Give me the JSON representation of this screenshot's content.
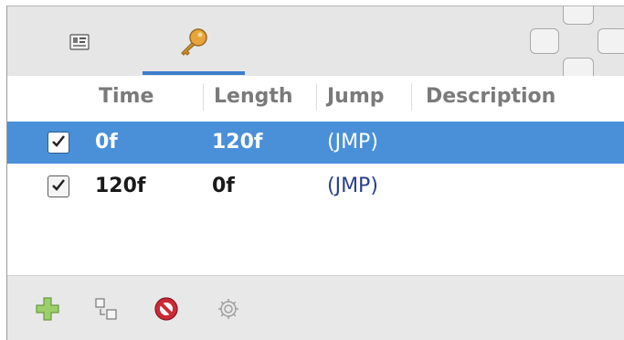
{
  "tabs": [
    {
      "name": "ids-tab",
      "icon": "id-card-icon",
      "active": false
    },
    {
      "name": "keys-tab",
      "icon": "key-icon",
      "active": true
    }
  ],
  "table": {
    "columns": [
      "Time",
      "Length",
      "Jump",
      "Description"
    ],
    "rows": [
      {
        "checked": true,
        "time": "0f",
        "length": "120f",
        "jump": "(JMP)",
        "description": "",
        "selected": true
      },
      {
        "checked": true,
        "time": "120f",
        "length": "0f",
        "jump": "(JMP)",
        "description": "",
        "selected": false
      }
    ]
  },
  "toolbar": {
    "buttons": [
      {
        "name": "add-button",
        "icon": "plus-icon"
      },
      {
        "name": "duplicate-button",
        "icon": "duplicate-icon"
      },
      {
        "name": "remove-button",
        "icon": "no-entry-icon"
      },
      {
        "name": "settings-button",
        "icon": "gear-icon"
      }
    ]
  },
  "colors": {
    "selection": "#4a90d9",
    "tab_underline": "#3c7ccc",
    "jump_text": "#2a3f8f"
  }
}
